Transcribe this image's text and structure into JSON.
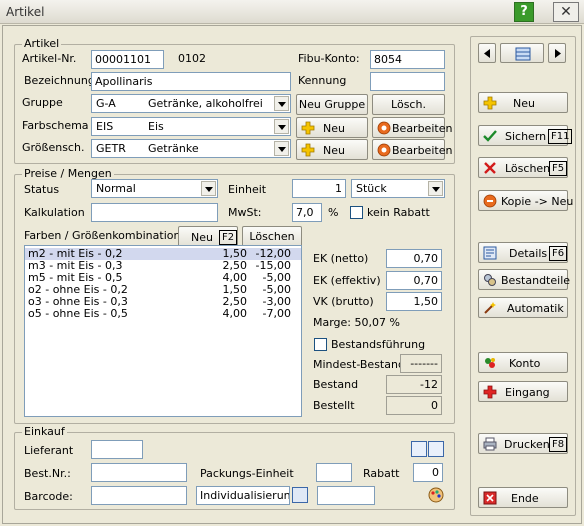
{
  "window": {
    "title": "Artikel",
    "help_label": "?",
    "close_label": "✕"
  },
  "artikel": {
    "legend": "Artikel",
    "artikel_nr_label": "Artikel-Nr.",
    "artikel_nr": "00001101",
    "sub_nr": "0102",
    "fibu_label": "Fibu-Konto:",
    "fibu": "8054",
    "bezeichnung_label": "Bezeichnung",
    "bezeichnung": "Apollinaris",
    "kennung_label": "Kennung",
    "kennung": "",
    "gruppe_label": "Gruppe",
    "gruppe_code": "G-A",
    "gruppe_desc": "Getränke, alkoholfrei",
    "neu_gruppe": "Neu Gruppe",
    "loesch": "Lösch.",
    "farbschema_label": "Farbschema",
    "farbschema_code": "EIS",
    "farbschema_desc": "Eis",
    "groessen_label": "Größensch.",
    "groessen_code": "GETR",
    "groessen_desc": "Getränke",
    "neu": "Neu",
    "bearbeiten": "Bearbeiten"
  },
  "preise": {
    "legend": "Preise / Mengen",
    "status_label": "Status",
    "status": "Normal",
    "einheit_label": "Einheit",
    "einheit_qty": "1",
    "einheit": "Stück",
    "kalkulation_label": "Kalkulation",
    "kalkulation": "",
    "mwst_label": "MwSt:",
    "mwst": "7,0",
    "percent": "%",
    "kein_rabatt": "kein Rabatt",
    "combos_label": "Farben / Größenkombination",
    "neu_label": "Neu",
    "neu_key": "F2",
    "loeschen_label": "Löschen",
    "rows": [
      [
        "m2 - mit Eis - 0,2",
        "1,50",
        "-12,00"
      ],
      [
        "m3 - mit Eis - 0,3",
        "2,50",
        "-15,00"
      ],
      [
        "m5 - mit Eis - 0,5",
        "4,00",
        "-5,00"
      ],
      [
        "o2 - ohne Eis - 0,2",
        "1,50",
        "-5,00"
      ],
      [
        "o3 - ohne Eis - 0,3",
        "2,50",
        "-3,00"
      ],
      [
        "o5 - ohne Eis - 0,5",
        "4,00",
        "-7,00"
      ]
    ],
    "ek_netto_label": "EK (netto)",
    "ek_netto": "0,70",
    "ek_eff_label": "EK (effektiv)",
    "ek_eff": "0,70",
    "vk_label": "VK (brutto)",
    "vk": "1,50",
    "marge": "Marge: 50,07 %",
    "bestandsfuehrung": "Bestandsführung",
    "mindest_label": "Mindest-Bestand",
    "mindest": "-------",
    "bestand_label": "Bestand",
    "bestand": "-12",
    "bestellt_label": "Bestellt",
    "bestellt": "0"
  },
  "einkauf": {
    "legend": "Einkauf",
    "lieferant_label": "Lieferant",
    "lieferant": "",
    "bestnr_label": "Best.Nr.:",
    "bestnr": "",
    "packung_label": "Packungs-Einheit",
    "packung": "",
    "rabatt_label": "Rabatt",
    "rabatt": "0",
    "barcode_label": "Barcode:",
    "barcode": "",
    "individualisierung": "Individualisierung",
    "barcode2": ""
  },
  "sidebar": {
    "neu": "Neu",
    "sichern": "Sichern",
    "sichern_key": "F11",
    "loeschen": "Löschen",
    "loeschen_key": "F5",
    "kopie": "Kopie -> Neu",
    "details": "Details",
    "details_key": "F6",
    "bestandteile": "Bestandteile",
    "automatik": "Automatik",
    "konto": "Konto",
    "eingang": "Eingang",
    "drucken": "Drucken",
    "drucken_key": "F8",
    "ende": "Ende"
  }
}
